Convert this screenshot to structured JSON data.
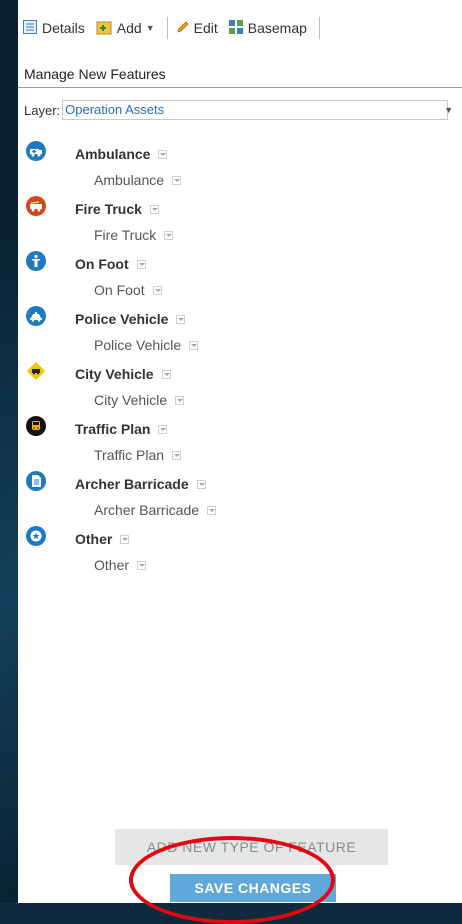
{
  "toolbar": {
    "details_label": "Details",
    "add_label": "Add",
    "edit_label": "Edit",
    "basemap_label": "Basemap"
  },
  "panel": {
    "title": "Manage New Features",
    "layer_label": "Layer:",
    "layer_value": "Operation Assets"
  },
  "features": [
    {
      "name": "Ambulance",
      "type": "Ambulance",
      "color": "#1f7ac0",
      "icon": "ambulance-icon"
    },
    {
      "name": "Fire Truck",
      "type": "Fire Truck",
      "color": "#d9441c",
      "icon": "fire-truck-icon"
    },
    {
      "name": "On Foot",
      "type": "On Foot",
      "color": "#1f7ac0",
      "icon": "person-icon"
    },
    {
      "name": "Police Vehicle",
      "type": "Police Vehicle",
      "color": "#1f7ac0",
      "icon": "police-car-icon"
    },
    {
      "name": "City Vehicle",
      "type": "City Vehicle",
      "color": "#f2c500",
      "icon": "city-vehicle-icon"
    },
    {
      "name": "Traffic Plan",
      "type": "Traffic Plan",
      "color": "#111111",
      "icon": "bus-icon"
    },
    {
      "name": "Archer Barricade",
      "type": "Archer Barricade",
      "color": "#1f7ac0",
      "icon": "document-icon"
    },
    {
      "name": "Other",
      "type": "Other",
      "color": "#1f7ac0",
      "icon": "star-badge-icon"
    }
  ],
  "buttons": {
    "add_new_type": "ADD NEW TYPE OF FEATURE",
    "save_changes": "SAVE CHANGES"
  },
  "colors": {
    "save_button": "#5fa8d9",
    "highlight_ring": "#e30613",
    "accent_text": "#2d6cb2"
  }
}
